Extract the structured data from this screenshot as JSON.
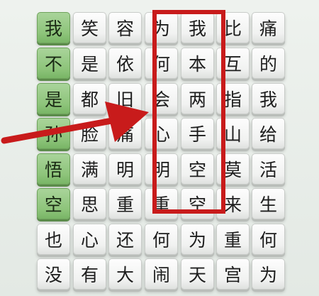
{
  "grid": {
    "rows": [
      [
        "我",
        "笑",
        "容",
        "为",
        "我",
        "比",
        "痛"
      ],
      [
        "不",
        "是",
        "依",
        "何",
        "本",
        "互",
        "的"
      ],
      [
        "是",
        "都",
        "旧",
        "会",
        "两",
        "指",
        "我"
      ],
      [
        "孙",
        "脸",
        "痛",
        "心",
        "手",
        "山",
        "给"
      ],
      [
        "悟",
        "满",
        "明",
        "明",
        "空",
        "莫",
        "活"
      ],
      [
        "空",
        "思",
        "重",
        "重",
        "空",
        "来",
        "生"
      ],
      [
        "也",
        "心",
        "还",
        "何",
        "为",
        "重",
        "何"
      ],
      [
        "没",
        "有",
        "大",
        "闹",
        "天",
        "宫",
        "为"
      ]
    ],
    "highlighted_column": 0,
    "highlighted_rows": 6
  },
  "annotation": {
    "color": "#c81b1b",
    "frame_column": 4,
    "frame_rows": 6
  }
}
